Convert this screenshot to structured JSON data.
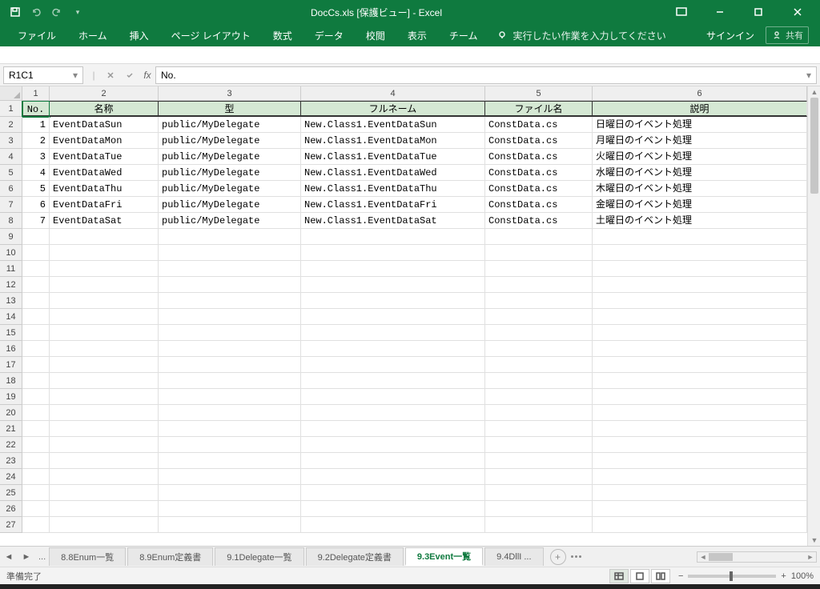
{
  "window": {
    "title": "DocCs.xls  [保護ビュー] - Excel"
  },
  "qat": {
    "save": "save",
    "undo": "undo",
    "redo": "redo"
  },
  "ribbon": {
    "tabs": [
      "ファイル",
      "ホーム",
      "挿入",
      "ページ レイアウト",
      "数式",
      "データ",
      "校閲",
      "表示",
      "チーム"
    ],
    "tell": "実行したい作業を入力してください",
    "signin": "サインイン",
    "share": "共有"
  },
  "formula": {
    "nameBox": "R1C1",
    "fxLabel": "fx",
    "value": "No."
  },
  "grid": {
    "colLabels": [
      "1",
      "2",
      "3",
      "4",
      "5",
      "6"
    ],
    "headers": [
      "No.",
      "名称",
      "型",
      "フルネーム",
      "ファイル名",
      "説明"
    ],
    "rows": [
      {
        "no": "1",
        "name": "EventDataSun",
        "type": "public/MyDelegate",
        "full": "New.Class1.EventDataSun",
        "file": "ConstData.cs",
        "desc": "日曜日のイベント処理"
      },
      {
        "no": "2",
        "name": "EventDataMon",
        "type": "public/MyDelegate",
        "full": "New.Class1.EventDataMon",
        "file": "ConstData.cs",
        "desc": "月曜日のイベント処理"
      },
      {
        "no": "3",
        "name": "EventDataTue",
        "type": "public/MyDelegate",
        "full": "New.Class1.EventDataTue",
        "file": "ConstData.cs",
        "desc": "火曜日のイベント処理"
      },
      {
        "no": "4",
        "name": "EventDataWed",
        "type": "public/MyDelegate",
        "full": "New.Class1.EventDataWed",
        "file": "ConstData.cs",
        "desc": "水曜日のイベント処理"
      },
      {
        "no": "5",
        "name": "EventDataThu",
        "type": "public/MyDelegate",
        "full": "New.Class1.EventDataThu",
        "file": "ConstData.cs",
        "desc": "木曜日のイベント処理"
      },
      {
        "no": "6",
        "name": "EventDataFri",
        "type": "public/MyDelegate",
        "full": "New.Class1.EventDataFri",
        "file": "ConstData.cs",
        "desc": "金曜日のイベント処理"
      },
      {
        "no": "7",
        "name": "EventDataSat",
        "type": "public/MyDelegate",
        "full": "New.Class1.EventDataSat",
        "file": "ConstData.cs",
        "desc": "土曜日のイベント処理"
      }
    ],
    "emptyRows": 19,
    "startRowLabel": 1
  },
  "sheets": {
    "tabs": [
      "8.8Enum一覧",
      "8.9Enum定義書",
      "9.1Delegate一覧",
      "9.2Delegate定義書",
      "9.3Event一覧",
      "9.4DllI ..."
    ],
    "active": 4
  },
  "status": {
    "ready": "準備完了",
    "zoom": "100%",
    "zoomMinus": "−",
    "zoomPlus": "+"
  }
}
